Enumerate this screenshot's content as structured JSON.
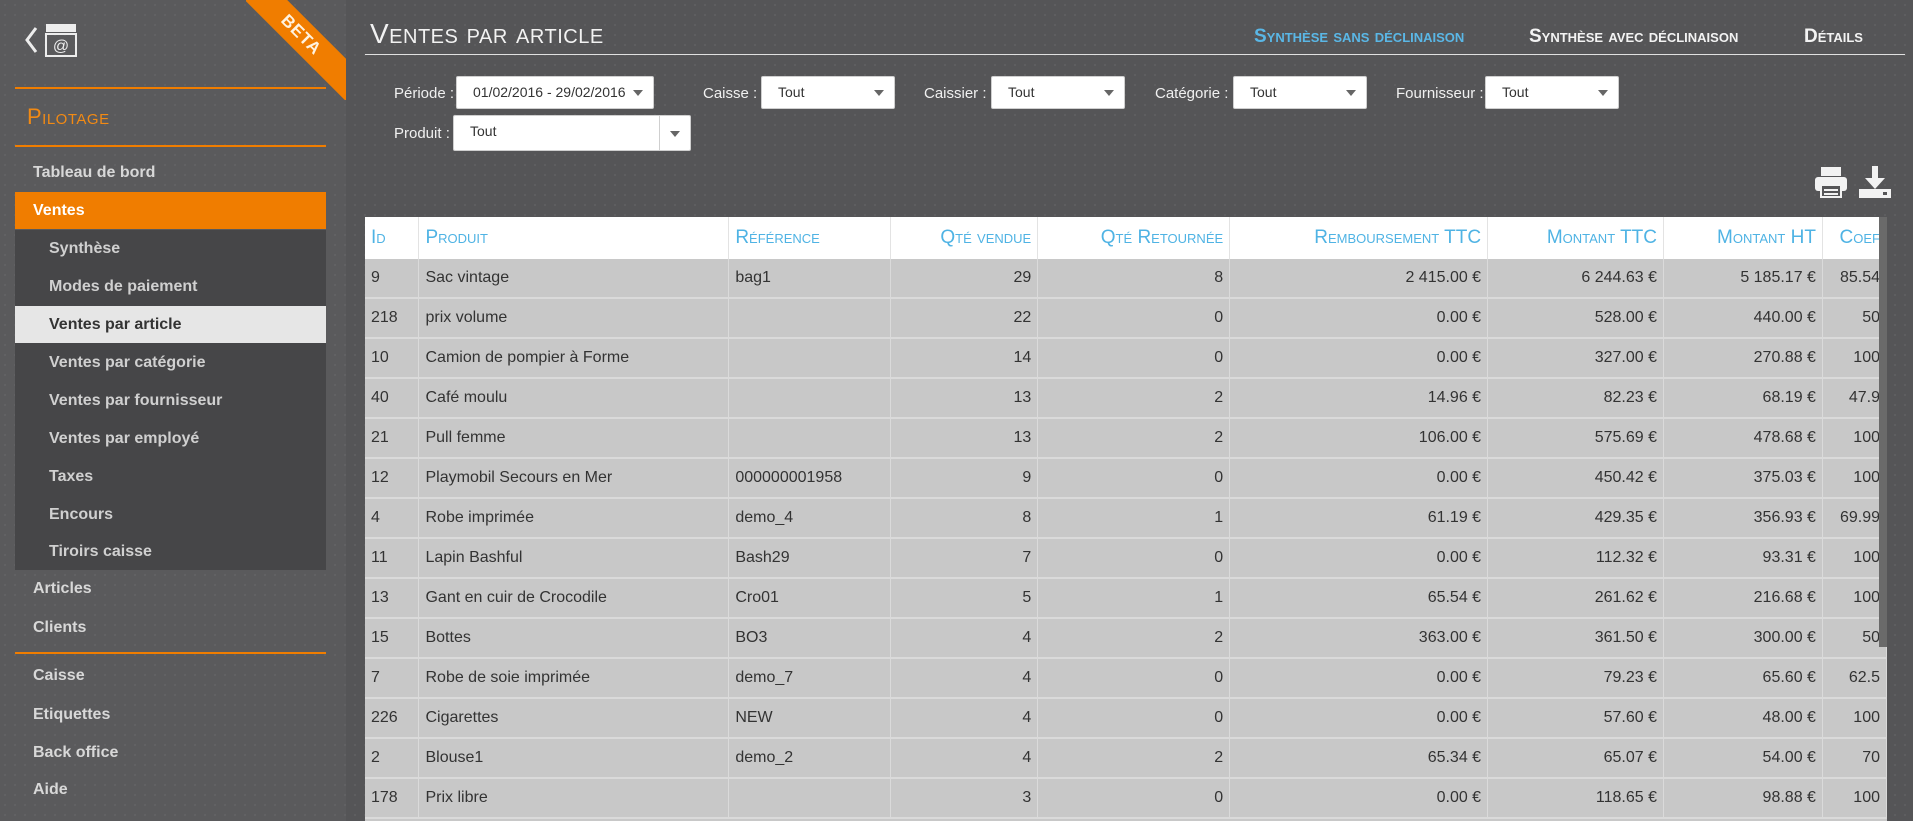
{
  "sidebar": {
    "beta": "BETA",
    "section_title": "Pilotage",
    "items": [
      {
        "label": "Tableau de bord"
      },
      {
        "label": "Ventes"
      },
      {
        "label": "Articles"
      },
      {
        "label": "Clients"
      },
      {
        "label": "Caisse"
      },
      {
        "label": "Etiquettes"
      },
      {
        "label": "Back office"
      },
      {
        "label": "Aide"
      }
    ],
    "sub_items": [
      {
        "label": "Synthèse"
      },
      {
        "label": "Modes de paiement"
      },
      {
        "label": "Ventes par article"
      },
      {
        "label": "Ventes par catégorie"
      },
      {
        "label": "Ventes par fournisseur"
      },
      {
        "label": "Ventes par employé"
      },
      {
        "label": "Taxes"
      },
      {
        "label": "Encours"
      },
      {
        "label": "Tiroirs caisse"
      }
    ]
  },
  "header": {
    "title": "Ventes par article",
    "tabs": [
      {
        "label": "Synthèse sans déclinaison"
      },
      {
        "label": "Synthèse avec déclinaison"
      },
      {
        "label": "Détails"
      }
    ]
  },
  "filters": {
    "periode": {
      "label": "Période :",
      "value": "01/02/2016 - 29/02/2016"
    },
    "caisse": {
      "label": "Caisse :",
      "value": "Tout"
    },
    "caissier": {
      "label": "Caissier :",
      "value": "Tout"
    },
    "categorie": {
      "label": "Catégorie :",
      "value": "Tout"
    },
    "fournisseur": {
      "label": "Fournisseur :",
      "value": "Tout"
    },
    "produit": {
      "label": "Produit :",
      "value": "Tout"
    }
  },
  "icons": {
    "print": "print-icon",
    "download": "download-icon"
  },
  "colors": {
    "accent": "#f07d00",
    "link": "#4fb3e4"
  },
  "table": {
    "headers": [
      "Id",
      "Produit",
      "Référence",
      "Qté vendue",
      "Qté Retournée",
      "Remboursement TTC",
      "Montant TTC",
      "Montant HT",
      "Coef"
    ],
    "rows": [
      [
        "9",
        "Sac vintage",
        "bag1",
        "29",
        "8",
        "2 415.00 €",
        "6 244.63 €",
        "5 185.17 €",
        "85.54"
      ],
      [
        "218",
        "prix volume",
        "",
        "22",
        "0",
        "0.00 €",
        "528.00 €",
        "440.00 €",
        "50"
      ],
      [
        "10",
        "Camion de pompier à Forme",
        "",
        "14",
        "0",
        "0.00 €",
        "327.00 €",
        "270.88 €",
        "100"
      ],
      [
        "40",
        "Café moulu",
        "",
        "13",
        "2",
        "14.96 €",
        "82.23 €",
        "68.19 €",
        "47.9"
      ],
      [
        "21",
        "Pull femme",
        "",
        "13",
        "2",
        "106.00 €",
        "575.69 €",
        "478.68 €",
        "100"
      ],
      [
        "12",
        "Playmobil Secours en Mer",
        "000000001958",
        "9",
        "0",
        "0.00 €",
        "450.42 €",
        "375.03 €",
        "100"
      ],
      [
        "4",
        "Robe imprimée",
        "demo_4",
        "8",
        "1",
        "61.19 €",
        "429.35 €",
        "356.93 €",
        "69.99"
      ],
      [
        "11",
        "Lapin Bashful",
        "Bash29",
        "7",
        "0",
        "0.00 €",
        "112.32 €",
        "93.31 €",
        "100"
      ],
      [
        "13",
        "Gant en cuir de Crocodile",
        "Cro01",
        "5",
        "1",
        "65.54 €",
        "261.62 €",
        "216.68 €",
        "100"
      ],
      [
        "15",
        "Bottes",
        "BO3",
        "4",
        "2",
        "363.00 €",
        "361.50 €",
        "300.00 €",
        "50"
      ],
      [
        "7",
        "Robe de soie imprimée",
        "demo_7",
        "4",
        "0",
        "0.00 €",
        "79.23 €",
        "65.60 €",
        "62.5"
      ],
      [
        "226",
        "Cigarettes",
        "NEW",
        "4",
        "0",
        "0.00 €",
        "57.60 €",
        "48.00 €",
        "100"
      ],
      [
        "2",
        "Blouse1",
        "demo_2",
        "4",
        "2",
        "65.34 €",
        "65.07 €",
        "54.00 €",
        "70"
      ],
      [
        "178",
        "Prix libre",
        "",
        "3",
        "0",
        "0.00 €",
        "118.65 €",
        "98.88 €",
        "100"
      ]
    ]
  }
}
